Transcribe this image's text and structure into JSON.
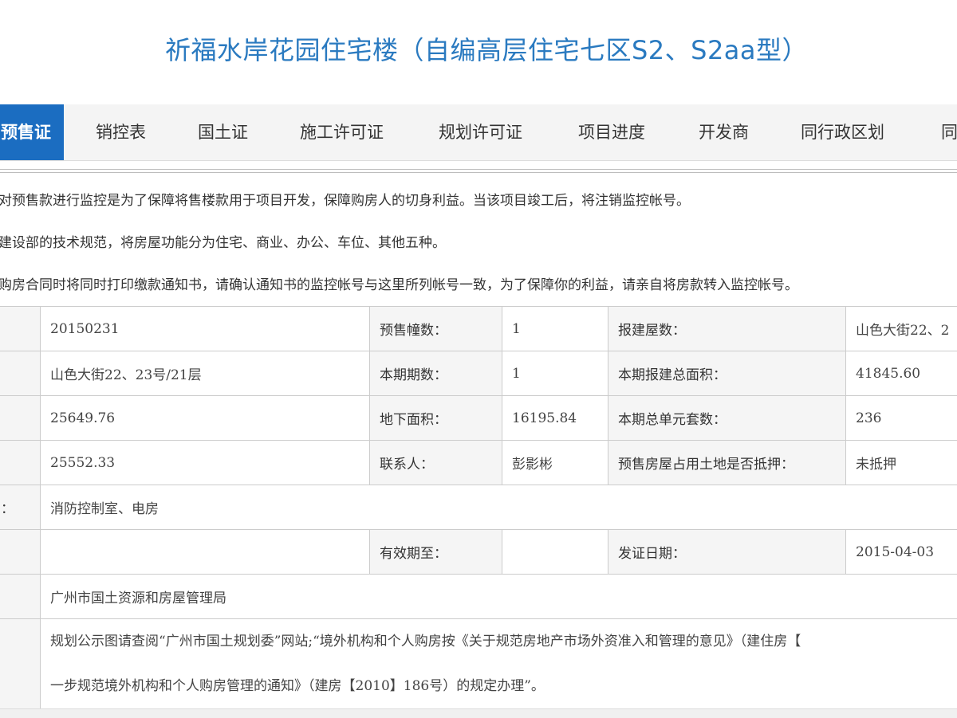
{
  "page_title": "祈福水岸花园住宅楼（自编高层住宅七区S2、S2aa型）",
  "tabs": [
    {
      "label": "预售证",
      "active": true
    },
    {
      "label": "销控表"
    },
    {
      "label": "国土证"
    },
    {
      "label": "施工许可证"
    },
    {
      "label": "规划许可证"
    },
    {
      "label": "项目进度"
    },
    {
      "label": "开发商"
    },
    {
      "label": "同行政区划"
    },
    {
      "label": "同"
    }
  ],
  "notices": [
    "对预售款进行监控是为了保障将售楼款用于项目开发，保障购房人的切身利益。当该项目竣工后，将注销监控帐号。",
    "建设部的技术规范，将房屋功能分为住宅、商业、办公、车位、其他五种。",
    "购房合同时将同时打印缴款通知书，请确认通知书的监控帐号与这里所列帐号一致，为了保障你的利益，请亲自将房款转入监控帐号。"
  ],
  "table": {
    "rows": [
      {
        "c0": "",
        "c1": "20150231",
        "l2": "预售幢数：",
        "v2": "1",
        "l3": "报建屋数：",
        "v3": "山色大街22、2"
      },
      {
        "c0": "",
        "c1": "山色大街22、23号/21层",
        "l2": "本期期数：",
        "v2": "1",
        "l3": "本期报建总面积：",
        "v3": "41845.60"
      },
      {
        "c0": "",
        "c1": "25649.76",
        "l2": "地下面积：",
        "v2": "16195.84",
        "l3": "本期总单元套数：",
        "v3": "236"
      },
      {
        "c0": "",
        "c1": "25552.33",
        "l2": "联系人：",
        "v2": "彭影彬",
        "l3": "预售房屋占用土地是否抵押：",
        "v3": "未抵押"
      },
      {
        "c0": "：",
        "c1": "消防控制室、电房"
      },
      {
        "c0": "",
        "c1": "",
        "l2": "有效期至：",
        "v2": "",
        "l3": "发证日期：",
        "v3": "2015-04-03"
      },
      {
        "c0": "",
        "c1": "广州市国土资源和房屋管理局"
      },
      {
        "c0": "",
        "remark_line1": "规划公示图请查阅“广州市国土规划委”网站;“境外机构和个人购房按《关于规范房地产市场外资准入和管理的意见》（建住房【",
        "remark_line2": "一步规范境外机构和个人购房管理的通知》（建房【2010】186号）的规定办理”。"
      }
    ]
  },
  "colors": {
    "title": "#2a7ac0",
    "active_tab": "#1b6dc1",
    "label_bg": "#f5f5f5",
    "border": "#cccccc"
  }
}
